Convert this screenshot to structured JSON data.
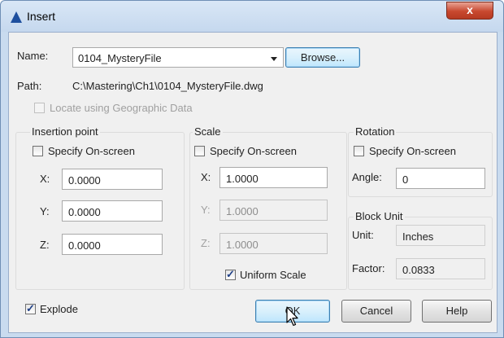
{
  "window": {
    "title": "Insert",
    "close_glyph": "x"
  },
  "name_row": {
    "label": "Name:",
    "value": "0104_MysteryFile",
    "browse_label": "Browse..."
  },
  "path_row": {
    "label": "Path:",
    "value": "C:\\Mastering\\Ch1\\0104_MysteryFile.dwg"
  },
  "geo": {
    "label": "Locate using Geographic Data",
    "checked": false
  },
  "insertion_point": {
    "title": "Insertion point",
    "specify_label": "Specify On-screen",
    "x_label": "X:",
    "x_value": "0.0000",
    "y_label": "Y:",
    "y_value": "0.0000",
    "z_label": "Z:",
    "z_value": "0.0000"
  },
  "scale": {
    "title": "Scale",
    "specify_label": "Specify On-screen",
    "x_label": "X:",
    "x_value": "1.0000",
    "y_label": "Y:",
    "y_value": "1.0000",
    "z_label": "Z:",
    "z_value": "1.0000",
    "uniform_label": "Uniform Scale",
    "uniform_checked": true
  },
  "rotation": {
    "title": "Rotation",
    "specify_label": "Specify On-screen",
    "angle_label": "Angle:",
    "angle_value": "0"
  },
  "block_unit": {
    "title": "Block Unit",
    "unit_label": "Unit:",
    "unit_value": "Inches",
    "factor_label": "Factor:",
    "factor_value": "0.0833"
  },
  "explode": {
    "label": "Explode",
    "checked": true
  },
  "buttons": {
    "ok": "OK",
    "cancel": "Cancel",
    "help": "Help"
  },
  "check_glyph": "✓",
  "colors": {
    "title_bar": "#c5d8ee",
    "close_button": "#c8482f",
    "dialog_bg": "#f0f0f0"
  }
}
